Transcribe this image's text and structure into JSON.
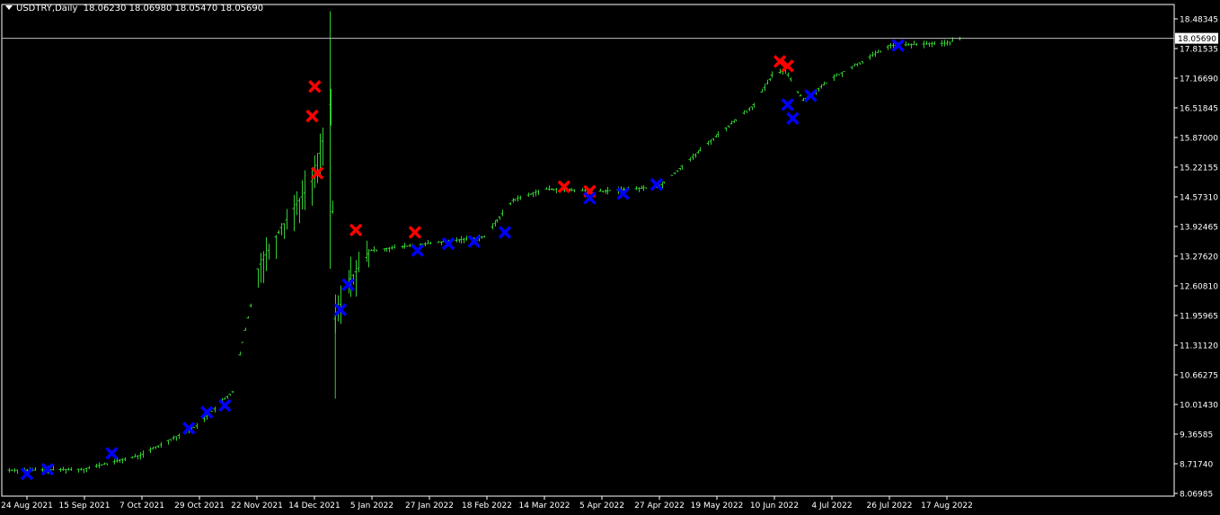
{
  "header": {
    "symbol_label": "USDTRY,Daily",
    "ohlc_text": "18.06230 18.06980 18.05470 18.05690"
  },
  "colors": {
    "background": "#000000",
    "axis": "#ffffff",
    "candle": "#32cd32",
    "sell_marker": "#ff0000",
    "buy_marker": "#0000ff",
    "price_line": "#c0c0c0"
  },
  "chart_data": {
    "type": "ohlc-bar",
    "title": "USDTRY,Daily",
    "current_price": "18.05690",
    "y_tick_labels": [
      "18.48345",
      "17.81535",
      "17.16690",
      "16.51845",
      "15.87000",
      "15.22155",
      "14.57310",
      "13.92465",
      "13.27620",
      "12.60810",
      "11.95965",
      "11.31120",
      "10.66275",
      "10.01430",
      "9.36585",
      "8.71740",
      "8.06985"
    ],
    "x_tick_labels": [
      "24 Aug 2021",
      "15 Sep 2021",
      "7 Oct 2021",
      "29 Oct 2021",
      "22 Nov 2021",
      "14 Dec 2021",
      "5 Jan 2022",
      "27 Jan 2022",
      "18 Feb 2022",
      "14 Mar 2022",
      "5 Apr 2022",
      "27 Apr 2022",
      "19 May 2022",
      "10 Jun 2022",
      "4 Jul 2022",
      "26 Jul 2022",
      "17 Aug 2022"
    ],
    "ylim": [
      8.06985,
      18.48345
    ],
    "grid": false,
    "series": [
      {
        "approx_close_path": [
          {
            "date": "2021-08-24",
            "close": 8.58
          },
          {
            "date": "2021-09-15",
            "close": 8.6
          },
          {
            "date": "2021-10-07",
            "close": 8.9
          },
          {
            "date": "2021-10-29",
            "close": 9.55
          },
          {
            "date": "2021-11-12",
            "close": 10.3
          },
          {
            "date": "2021-11-22",
            "close": 13.0
          },
          {
            "date": "2021-12-01",
            "close": 13.9
          },
          {
            "date": "2021-12-14",
            "close": 15.0
          },
          {
            "date": "2021-12-20",
            "close": 16.6
          },
          {
            "date": "2021-12-22",
            "close": 11.9
          },
          {
            "date": "2021-12-27",
            "close": 12.7
          },
          {
            "date": "2022-01-05",
            "close": 13.4
          },
          {
            "date": "2022-01-27",
            "close": 13.55
          },
          {
            "date": "2022-02-18",
            "close": 13.7
          },
          {
            "date": "2022-03-01",
            "close": 14.5
          },
          {
            "date": "2022-03-14",
            "close": 14.75
          },
          {
            "date": "2022-04-05",
            "close": 14.7
          },
          {
            "date": "2022-04-27",
            "close": 14.8
          },
          {
            "date": "2022-05-19",
            "close": 15.9
          },
          {
            "date": "2022-06-03",
            "close": 16.6
          },
          {
            "date": "2022-06-10",
            "close": 17.25
          },
          {
            "date": "2022-06-15",
            "close": 17.35
          },
          {
            "date": "2022-06-22",
            "close": 16.7
          },
          {
            "date": "2022-07-04",
            "close": 17.2
          },
          {
            "date": "2022-07-26",
            "close": 17.9
          },
          {
            "date": "2022-08-17",
            "close": 17.95
          },
          {
            "date": "2022-08-22",
            "close": 18.05
          }
        ]
      }
    ],
    "sell_markers": [
      {
        "date": "2021-12-14",
        "price": 17.0
      },
      {
        "date": "2021-12-13",
        "price": 16.35
      },
      {
        "date": "2021-12-15",
        "price": 15.1
      },
      {
        "date": "2021-12-30",
        "price": 13.85
      },
      {
        "date": "2022-01-22",
        "price": 13.8
      },
      {
        "date": "2022-03-21",
        "price": 14.8
      },
      {
        "date": "2022-03-31",
        "price": 14.7
      },
      {
        "date": "2022-06-13",
        "price": 17.55
      },
      {
        "date": "2022-06-16",
        "price": 17.45
      }
    ],
    "buy_markers": [
      {
        "date": "2021-08-24",
        "price": 8.5
      },
      {
        "date": "2021-09-01",
        "price": 8.6
      },
      {
        "date": "2021-09-26",
        "price": 8.95
      },
      {
        "date": "2021-10-26",
        "price": 9.5
      },
      {
        "date": "2021-11-02",
        "price": 9.85
      },
      {
        "date": "2021-11-09",
        "price": 10.0
      },
      {
        "date": "2021-12-24",
        "price": 12.1
      },
      {
        "date": "2021-12-27",
        "price": 12.65
      },
      {
        "date": "2022-01-23",
        "price": 13.4
      },
      {
        "date": "2022-02-04",
        "price": 13.55
      },
      {
        "date": "2022-02-14",
        "price": 13.6
      },
      {
        "date": "2022-02-26",
        "price": 13.8
      },
      {
        "date": "2022-03-31",
        "price": 14.55
      },
      {
        "date": "2022-04-13",
        "price": 14.65
      },
      {
        "date": "2022-04-26",
        "price": 14.85
      },
      {
        "date": "2022-06-16",
        "price": 16.6
      },
      {
        "date": "2022-06-18",
        "price": 16.3
      },
      {
        "date": "2022-06-25",
        "price": 16.8
      },
      {
        "date": "2022-07-29",
        "price": 17.9
      }
    ]
  }
}
